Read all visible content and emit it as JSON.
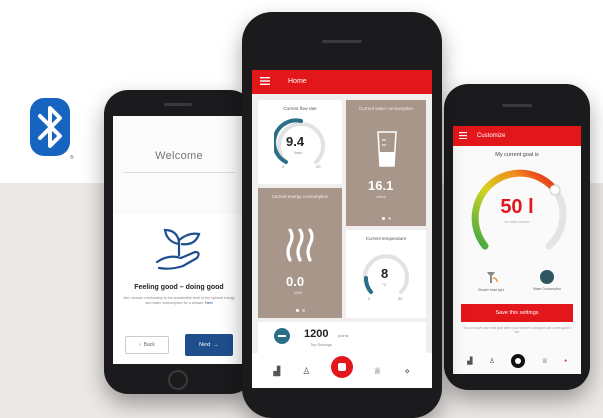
{
  "colors": {
    "brand_red": "#e3171b",
    "tile_brown": "#a8968b",
    "bluetooth_blue": "#1565c0",
    "next_blue": "#1f4e8c"
  },
  "icons": [
    "bluetooth-icon",
    "plant-hand-icon",
    "menu-icon",
    "faucet-icon",
    "water-drop-icon",
    "thermometer-icon",
    "steam-icon",
    "shower-icon",
    "home-icon"
  ],
  "left_phone": {
    "title": "Welcome",
    "heading": "Feeling good – doing good",
    "body": "Aim: shower comfortably to the sustainable level of the optimal energy and water consumption for a shower.",
    "link": "Next",
    "back_label": "Back",
    "next_label": "Next"
  },
  "center_phone": {
    "header_title": "Home",
    "flow_rate": {
      "label": "Current flow rate",
      "value": "9.4",
      "unit": "l/min",
      "min": "0",
      "max": "20",
      "fill": 0.47
    },
    "water": {
      "label": "Current water consumption",
      "value": "16.1",
      "unit": "Liters"
    },
    "energy": {
      "label": "Current energy consumption",
      "value": "0.0",
      "unit": "kWh"
    },
    "temperature": {
      "label": "Current temperature",
      "value": "8",
      "unit": "°C",
      "min": "0",
      "max": "50"
    },
    "points": {
      "value": "1200",
      "unit": "points",
      "sub": "Top Savings"
    }
  },
  "right_phone": {
    "header_title": "Customize",
    "goal_label": "My current goal is",
    "goal_value": "50 l",
    "goal_sub": "for each shower",
    "icon_shower_label": "Shower head light",
    "icon_water_label": "Water Consumption",
    "save_label": "Save this settings",
    "hint": "You can save your new goal when your shower is stopped and a new goal is set."
  }
}
